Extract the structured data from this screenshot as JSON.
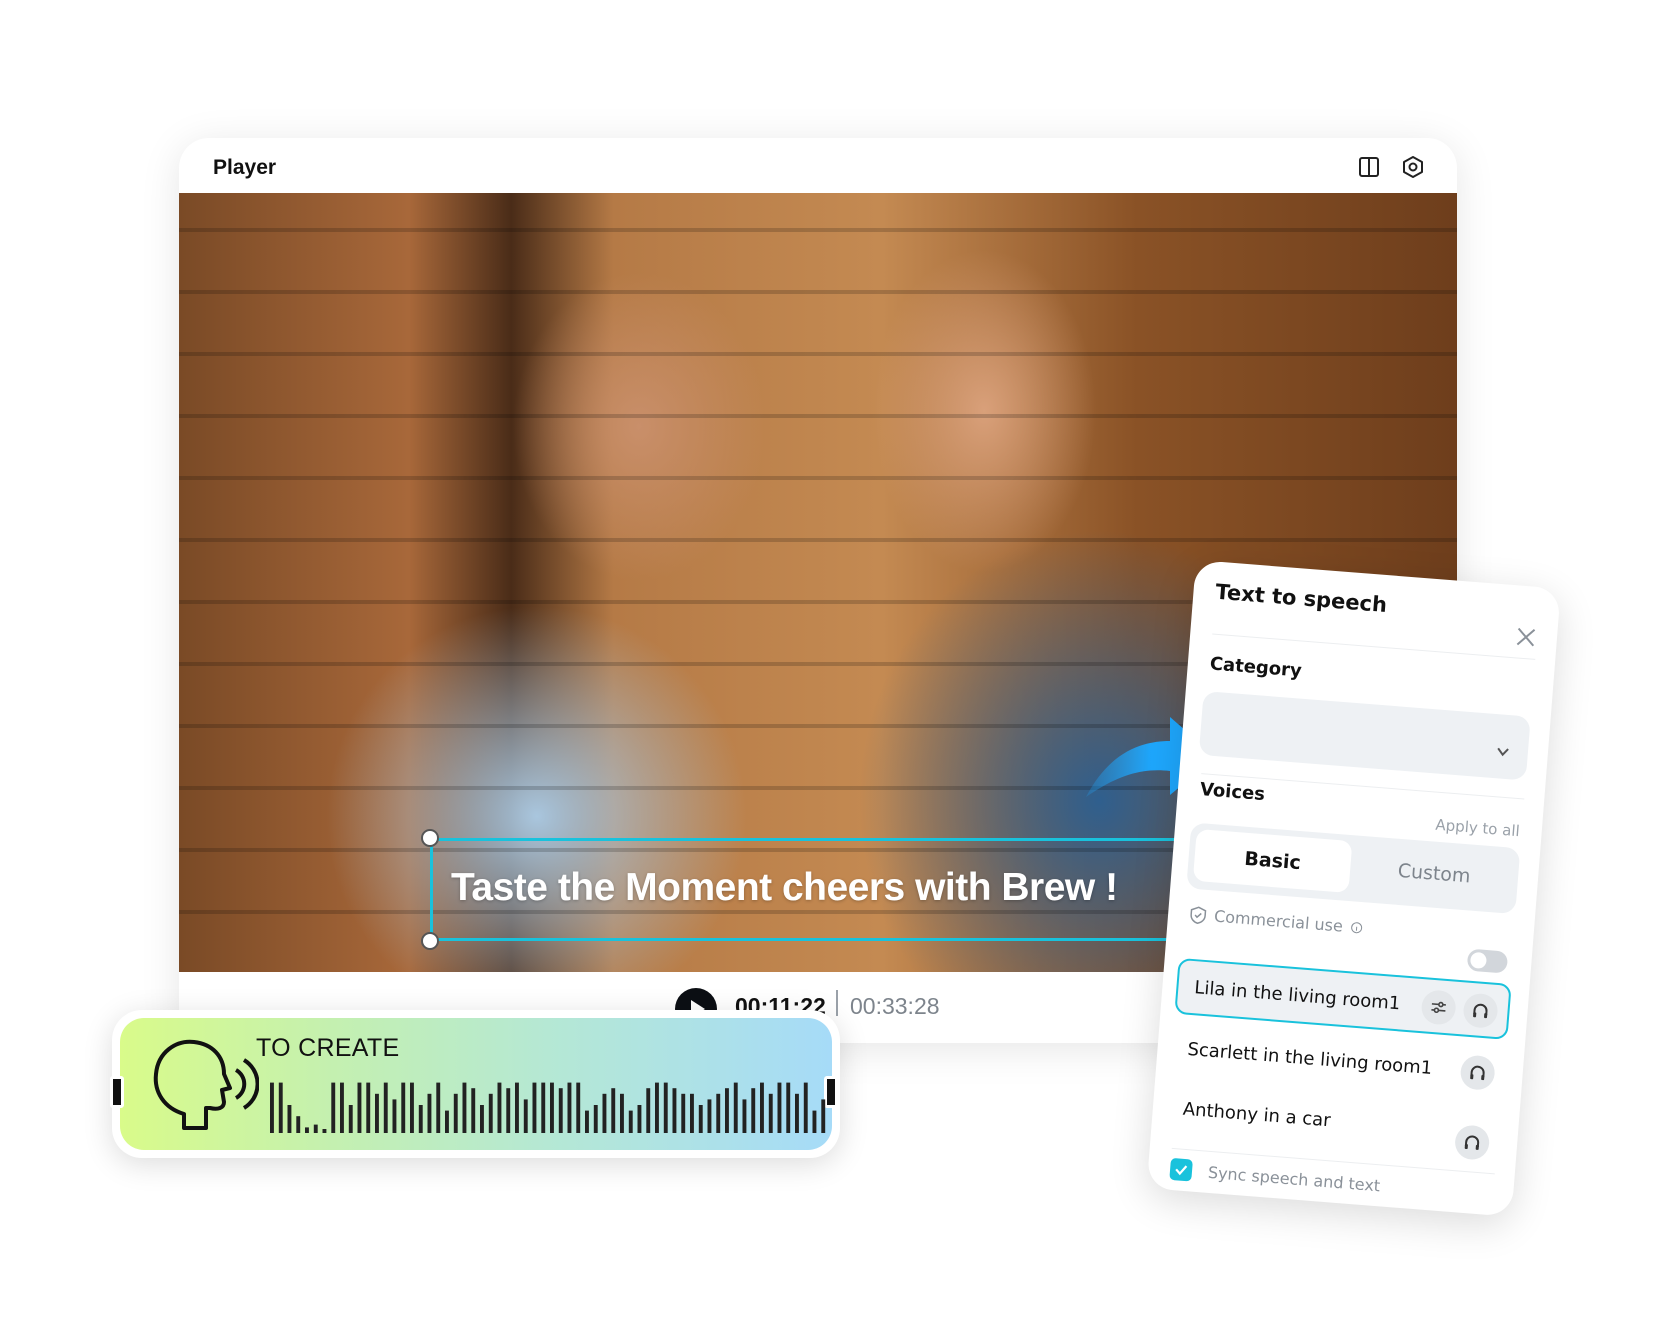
{
  "player": {
    "title": "Player",
    "icons": [
      "split-view-icon",
      "settings-hex-icon"
    ],
    "caption": "Taste the Moment cheers with Brew !",
    "time_current": "00:11:22",
    "time_total": "00:33:28"
  },
  "tts_clip": {
    "label": "TO CREATE",
    "waveform": [
      0.9,
      0.9,
      0.5,
      0.3,
      0.1,
      0.15,
      0,
      0.9,
      0.9,
      0.5,
      0.9,
      0.9,
      0.7,
      0.9,
      0.6,
      0.9,
      0.9,
      0.5,
      0.7,
      0.9,
      0.4,
      0.7,
      0.9,
      0.8,
      0.5,
      0.7,
      0.9,
      0.8,
      0.9,
      0.6,
      0.9,
      0.9,
      0.9,
      0.8,
      0.9,
      0.9,
      0.4,
      0.5,
      0.7,
      0.8,
      0.7,
      0.4,
      0.5,
      0.8,
      0.9,
      0.9,
      0.8,
      0.7,
      0.7,
      0.5,
      0.6,
      0.7,
      0.8,
      0.9,
      0.6,
      0.8,
      0.9,
      0.7,
      0.9,
      0.9,
      0.7,
      0.9,
      0.4,
      0.6
    ]
  },
  "panel": {
    "title": "Text to speech",
    "category_label": "Category",
    "category_value": "",
    "voices_label": "Voices",
    "apply_all": "Apply to all",
    "tabs": {
      "basic": "Basic",
      "custom": "Custom",
      "active": "Basic"
    },
    "commercial_use": "Commercial use",
    "commercial_toggle": false,
    "voices": [
      {
        "name": "Lila in the living room1",
        "selected": true
      },
      {
        "name": "Scarlett in the living room1",
        "selected": false
      },
      {
        "name": "Anthony in a car",
        "selected": false
      }
    ],
    "sync_label": "Sync speech and text",
    "sync_checked": true
  },
  "colors": {
    "accent": "#19c2dc",
    "arrow": "#1ea7fd"
  }
}
